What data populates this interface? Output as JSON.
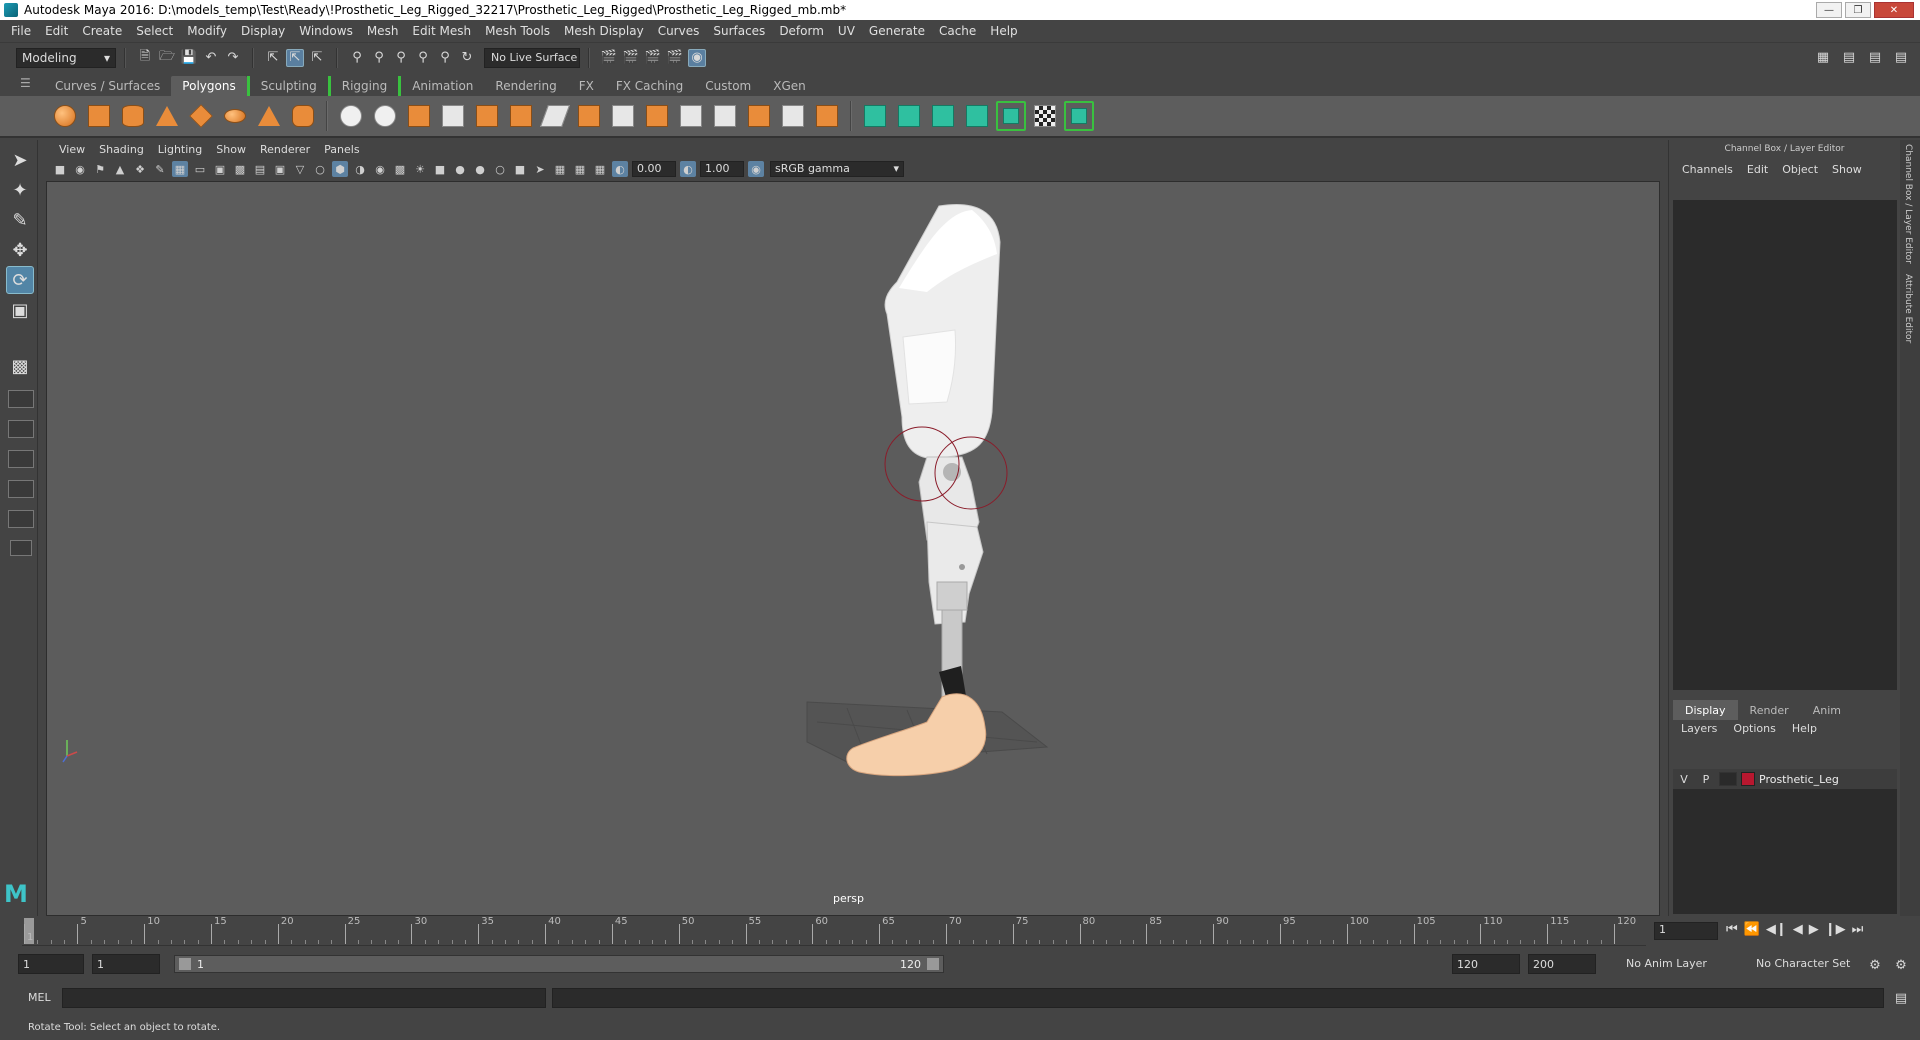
{
  "window": {
    "title": "Autodesk Maya 2016: D:\\models_temp\\Test\\Ready\\!Prosthetic_Leg_Rigged_32217\\Prosthetic_Leg_Rigged\\Prosthetic_Leg_Rigged_mb.mb*"
  },
  "menubar": [
    "File",
    "Edit",
    "Create",
    "Select",
    "Modify",
    "Display",
    "Windows",
    "Mesh",
    "Edit Mesh",
    "Mesh Tools",
    "Mesh Display",
    "Curves",
    "Surfaces",
    "Deform",
    "UV",
    "Generate",
    "Cache",
    "Help"
  ],
  "statusline": {
    "mode": "Modeling",
    "live_surface": "No Live Surface"
  },
  "shelf_tabs": [
    "Curves / Surfaces",
    "Polygons",
    "Sculpting",
    "Rigging",
    "Animation",
    "Rendering",
    "FX",
    "FX Caching",
    "Custom",
    "XGen"
  ],
  "shelf_active_tab": "Polygons",
  "viewport": {
    "menus": [
      "View",
      "Shading",
      "Lighting",
      "Show",
      "Renderer",
      "Panels"
    ],
    "exposure": "0.00",
    "gamma": "1.00",
    "color_space": "sRGB gamma",
    "camera_label": "persp"
  },
  "channel_box": {
    "title": "Channel Box / Layer Editor",
    "menus": [
      "Channels",
      "Edit",
      "Object",
      "Show"
    ],
    "layer_tabs": [
      "Display",
      "Render",
      "Anim"
    ],
    "layer_active_tab": "Display",
    "layer_menus": [
      "Layers",
      "Options",
      "Help"
    ],
    "layers": [
      {
        "v": "V",
        "p": "P",
        "name": "Prosthetic_Leg",
        "color": "#b8172f"
      }
    ],
    "side_tabs": [
      "Channel Box / Layer Editor",
      "Attribute Editor"
    ]
  },
  "timeslider": {
    "ticks": [
      1,
      5,
      10,
      15,
      20,
      25,
      30,
      35,
      40,
      45,
      50,
      55,
      60,
      65,
      70,
      75,
      80,
      85,
      90,
      95,
      100,
      105,
      110,
      115,
      120
    ],
    "current_frame": "1"
  },
  "rangeslider": {
    "start_time": "1",
    "playback_start": "1",
    "range_start": "1",
    "range_end": "120",
    "playback_end": "120",
    "end_time": "200",
    "anim_layer": "No Anim Layer",
    "character_set": "No Character Set"
  },
  "cmdline": {
    "label": "MEL"
  },
  "helpline": {
    "text": "Rotate Tool: Select an object to rotate."
  }
}
